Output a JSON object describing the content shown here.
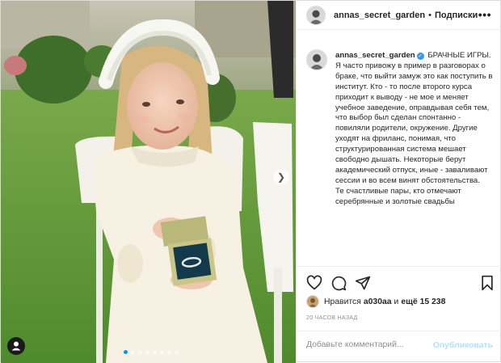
{
  "account": {
    "username": "annas_secret_garden",
    "separator": "•",
    "follow_label": "Подписки",
    "more_label": "•••"
  },
  "caption": {
    "username": "annas_secret_garden",
    "verified_mark": "✓",
    "paragraph_1": "БРАЧНЫЕ ИГРЫ.\nЯ часто привожу в пример в разговорах о браке, что выйти замуж это как поступить в институт. Кто - то после второго курса приходит к выводу - не мое и меняет учебное заведение, оправдывая себя тем, что выбор был сделан спонтанно - повиляли родители, окружение. Другие уходят на фриланс, понимая, что структурированная система мешает свободно дышать. Некоторые берут академический отпуск, иные - заваливают сессии и во всем винят обстоятельства.",
    "paragraph_2": "Те счастливые пары, кто отмечают серебрянные и золотые свадьбы"
  },
  "likes": {
    "prefix": "Нравится",
    "user": "a030aa",
    "middle": "и",
    "others": "ещё 15 238"
  },
  "timestamp": "20 ЧАСОВ НАЗАД",
  "comment": {
    "placeholder": "Добавьте комментарий...",
    "publish_label": "Опубликовать"
  },
  "carousel": {
    "slide_count": 8,
    "active_index": 0,
    "next_icon": "chevron-right-icon"
  },
  "icons": [
    "heart-icon",
    "comment-icon",
    "share-icon",
    "bookmark-icon",
    "user-tag-icon",
    "more-icon"
  ],
  "colors": {
    "accent": "#0095f6",
    "verified": "#3897f0",
    "publish_disabled": "#b2dffc",
    "text": "#262626",
    "muted": "#8e8e8e"
  }
}
